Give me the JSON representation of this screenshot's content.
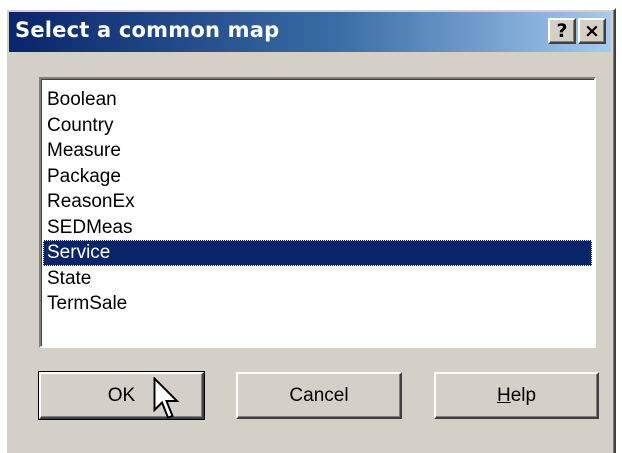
{
  "window": {
    "title": "Select a common map",
    "help_button": "?",
    "close_button": "×"
  },
  "list": {
    "items": [
      "Boolean",
      "Country",
      "Measure",
      "Package",
      "ReasonEx",
      "SEDMeas",
      "Service",
      "State",
      "TermSale"
    ],
    "selected": "Service"
  },
  "buttons": {
    "ok": "OK",
    "cancel": "Cancel",
    "help_mnemonic": "H",
    "help_rest": "elp"
  },
  "colors": {
    "dialog_bg": "#d4d0c8",
    "title_start": "#0a246a",
    "title_end": "#a6caf0",
    "selection": "#0a246a"
  },
  "icons": {
    "cursor": "arrow-cursor-icon"
  }
}
